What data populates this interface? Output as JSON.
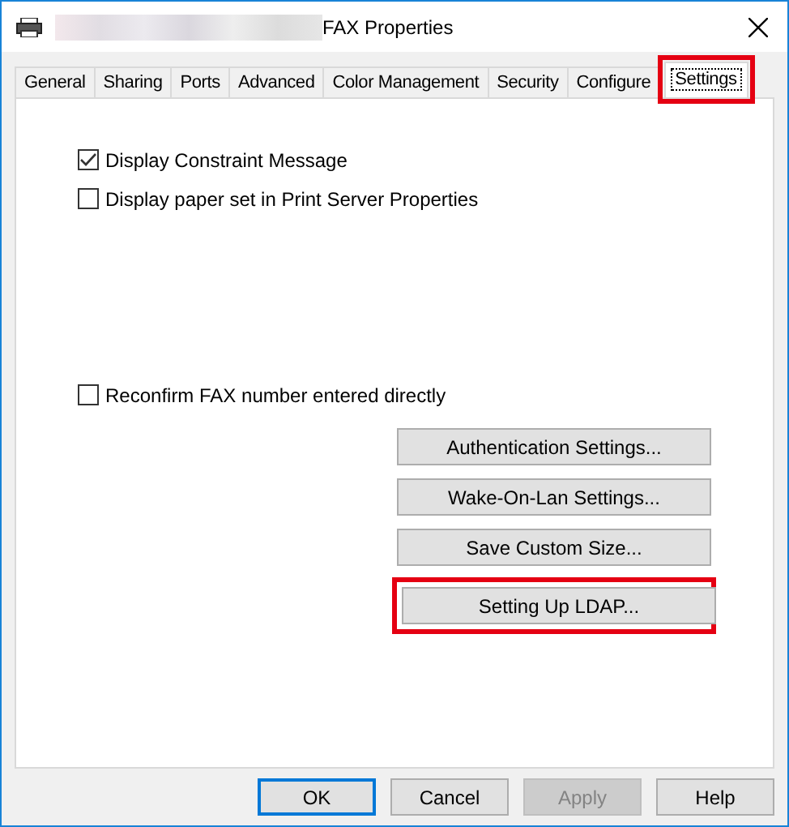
{
  "window": {
    "title": "FAX Properties"
  },
  "tabs": [
    {
      "label": "General",
      "selected": false,
      "highlighted": false
    },
    {
      "label": "Sharing",
      "selected": false,
      "highlighted": false
    },
    {
      "label": "Ports",
      "selected": false,
      "highlighted": false
    },
    {
      "label": "Advanced",
      "selected": false,
      "highlighted": false
    },
    {
      "label": "Color Management",
      "selected": false,
      "highlighted": false
    },
    {
      "label": "Security",
      "selected": false,
      "highlighted": false
    },
    {
      "label": "Configure",
      "selected": false,
      "highlighted": false
    },
    {
      "label": "Settings",
      "selected": true,
      "highlighted": true
    }
  ],
  "option_groups": [
    [
      {
        "label": "Display Constraint Message",
        "checked": true
      },
      {
        "label": "Display paper set in Print Server Properties",
        "checked": false
      }
    ],
    [
      {
        "label": "Reconfirm FAX number entered directly",
        "checked": false
      }
    ]
  ],
  "actions": [
    {
      "label": "Authentication Settings...",
      "highlighted": false
    },
    {
      "label": "Wake-On-Lan Settings...",
      "highlighted": false
    },
    {
      "label": "Save Custom Size...",
      "highlighted": false
    },
    {
      "label": "Setting Up LDAP...",
      "highlighted": true
    }
  ],
  "buttons": [
    {
      "label": "OK",
      "default": true,
      "disabled": false
    },
    {
      "label": "Cancel",
      "default": false,
      "disabled": false
    },
    {
      "label": "Apply",
      "default": false,
      "disabled": true
    },
    {
      "label": "Help",
      "default": false,
      "disabled": false
    }
  ]
}
